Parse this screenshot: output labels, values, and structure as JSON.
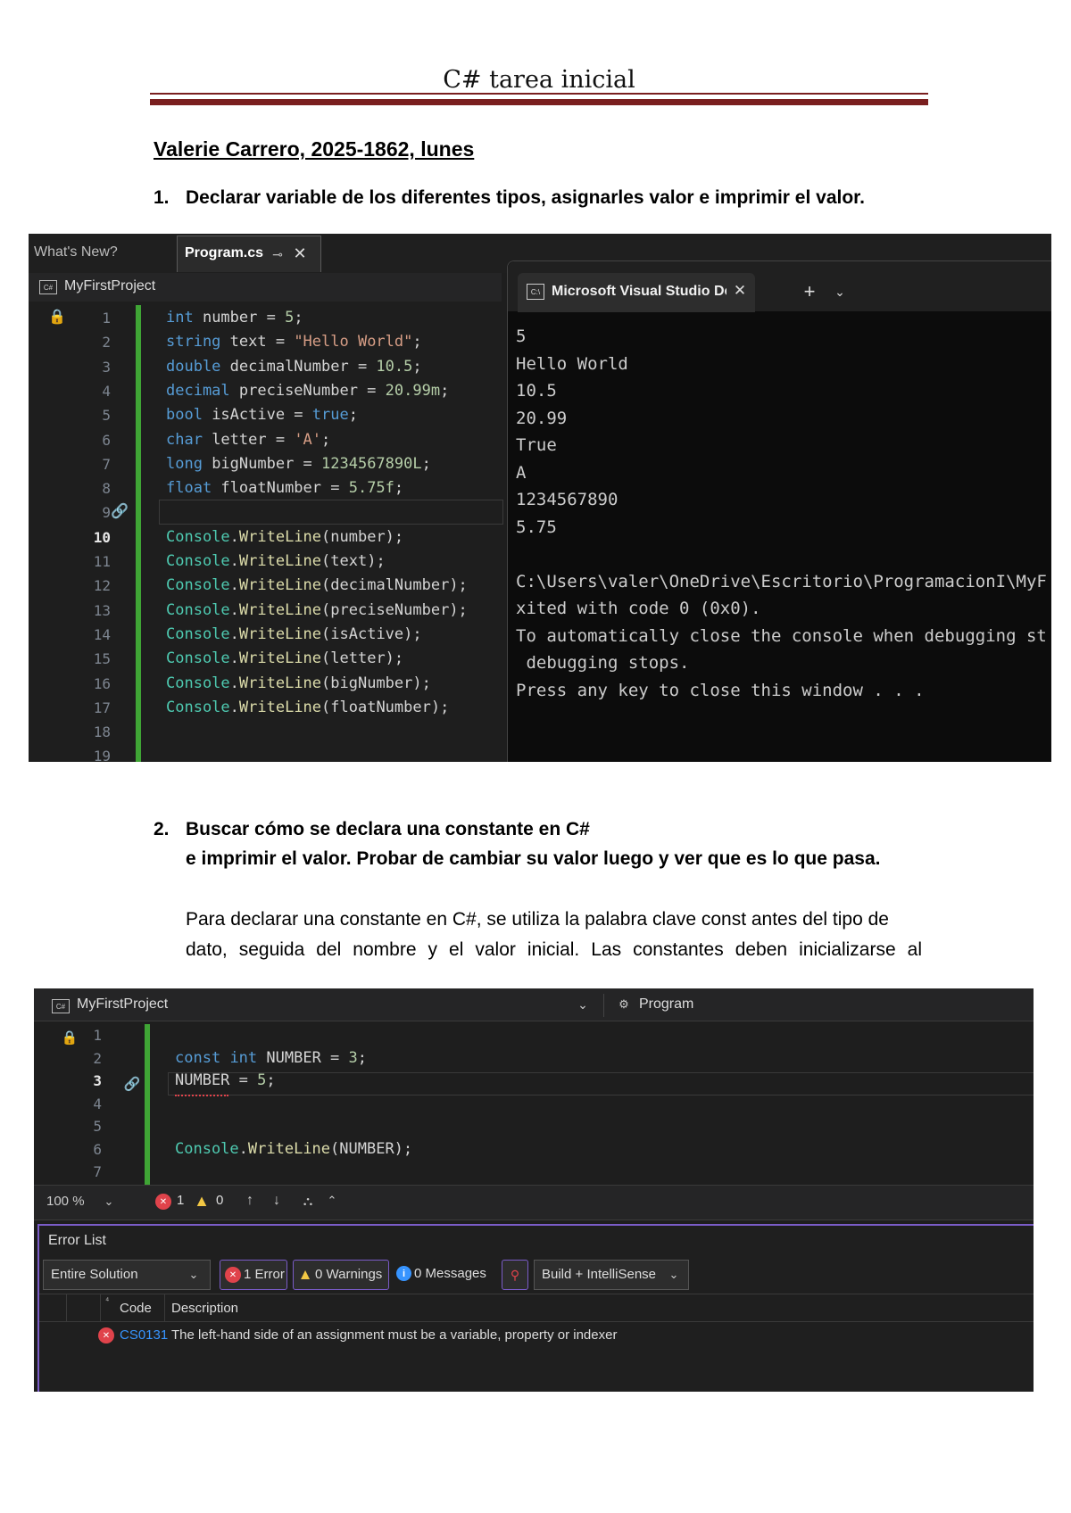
{
  "document": {
    "title": "C# tarea inicial",
    "author_line": "Valerie Carrero, 2025-1862, lunes",
    "q1_number": "1.",
    "q1_text": "Declarar variable de los diferentes tipos, asignarles valor e imprimir el valor.",
    "q2_number": "2.",
    "q2_line1": "Buscar cómo se declara una constante en C#",
    "q2_line2": "e imprimir el valor.  Probar de cambiar su valor luego y ver que es lo que pasa.",
    "q2_para_line1": "Para declarar una constante en C#, se utiliza la palabra clave const antes del tipo de",
    "q2_para_line2": "dato, seguida del nombre y el valor inicial. Las constantes deben inicializarse al"
  },
  "shot1": {
    "tab_whats_new": "What's New?",
    "tab_program": "Program.cs",
    "project": "MyFirstProject",
    "console_tab": "Microsoft Visual Studio Debu",
    "console_plus": "+",
    "code": [
      {
        "ln": "1",
        "parts": [
          [
            "kw",
            "int"
          ],
          [
            "id",
            " number = "
          ],
          [
            "num",
            "5"
          ],
          [
            "id",
            ";"
          ]
        ]
      },
      {
        "ln": "2",
        "parts": [
          [
            "kw",
            "string"
          ],
          [
            "id",
            " text = "
          ],
          [
            "str",
            "\"Hello World\""
          ],
          [
            "id",
            ";"
          ]
        ]
      },
      {
        "ln": "3",
        "parts": [
          [
            "kw",
            "double"
          ],
          [
            "id",
            " decimalNumber = "
          ],
          [
            "num",
            "10.5"
          ],
          [
            "id",
            ";"
          ]
        ]
      },
      {
        "ln": "4",
        "parts": [
          [
            "kw",
            "decimal"
          ],
          [
            "id",
            " preciseNumber = "
          ],
          [
            "num",
            "20.99m"
          ],
          [
            "id",
            ";"
          ]
        ]
      },
      {
        "ln": "5",
        "parts": [
          [
            "kw",
            "bool"
          ],
          [
            "id",
            " isActive = "
          ],
          [
            "kw",
            "true"
          ],
          [
            "id",
            ";"
          ]
        ]
      },
      {
        "ln": "6",
        "parts": [
          [
            "kw",
            "char"
          ],
          [
            "id",
            " letter = "
          ],
          [
            "str",
            "'A'"
          ],
          [
            "id",
            ";"
          ]
        ]
      },
      {
        "ln": "7",
        "parts": [
          [
            "kw",
            "long"
          ],
          [
            "id",
            " bigNumber = "
          ],
          [
            "num",
            "1234567890L"
          ],
          [
            "id",
            ";"
          ]
        ]
      },
      {
        "ln": "8",
        "parts": [
          [
            "kw",
            "float"
          ],
          [
            "id",
            " floatNumber = "
          ],
          [
            "num",
            "5.75f"
          ],
          [
            "id",
            ";"
          ]
        ]
      },
      {
        "ln": "9",
        "parts": []
      },
      {
        "ln": "10",
        "parts": [
          [
            "type",
            "Console"
          ],
          [
            "id",
            "."
          ],
          [
            "mth",
            "WriteLine"
          ],
          [
            "id",
            "(number);"
          ]
        ]
      },
      {
        "ln": "11",
        "parts": [
          [
            "type",
            "Console"
          ],
          [
            "id",
            "."
          ],
          [
            "mth",
            "WriteLine"
          ],
          [
            "id",
            "(text);"
          ]
        ]
      },
      {
        "ln": "12",
        "parts": [
          [
            "type",
            "Console"
          ],
          [
            "id",
            "."
          ],
          [
            "mth",
            "WriteLine"
          ],
          [
            "id",
            "(decimalNumber);"
          ]
        ]
      },
      {
        "ln": "13",
        "parts": [
          [
            "type",
            "Console"
          ],
          [
            "id",
            "."
          ],
          [
            "mth",
            "WriteLine"
          ],
          [
            "id",
            "(preciseNumber);"
          ]
        ]
      },
      {
        "ln": "14",
        "parts": [
          [
            "type",
            "Console"
          ],
          [
            "id",
            "."
          ],
          [
            "mth",
            "WriteLine"
          ],
          [
            "id",
            "(isActive);"
          ]
        ]
      },
      {
        "ln": "15",
        "parts": [
          [
            "type",
            "Console"
          ],
          [
            "id",
            "."
          ],
          [
            "mth",
            "WriteLine"
          ],
          [
            "id",
            "(letter);"
          ]
        ]
      },
      {
        "ln": "16",
        "parts": [
          [
            "type",
            "Console"
          ],
          [
            "id",
            "."
          ],
          [
            "mth",
            "WriteLine"
          ],
          [
            "id",
            "(bigNumber);"
          ]
        ]
      },
      {
        "ln": "17",
        "parts": [
          [
            "type",
            "Console"
          ],
          [
            "id",
            "."
          ],
          [
            "mth",
            "WriteLine"
          ],
          [
            "id",
            "(floatNumber);"
          ]
        ]
      },
      {
        "ln": "18",
        "parts": []
      },
      {
        "ln": "19",
        "parts": []
      }
    ],
    "console_lines": [
      "5",
      "Hello World",
      "10.5",
      "20.99",
      "True",
      "A",
      "1234567890",
      "5.75",
      "",
      "C:\\Users\\valer\\OneDrive\\Escritorio\\ProgramacionI\\MyF",
      "xited with code 0 (0x0).",
      "To automatically close the console when debugging st",
      " debugging stops.",
      "Press any key to close this window . . ."
    ]
  },
  "shot2": {
    "project": "MyFirstProject",
    "member_dropdown": "Program",
    "code": [
      {
        "ln": "1",
        "parts": []
      },
      {
        "ln": "2",
        "parts": [
          [
            "kw",
            "const"
          ],
          [
            "id",
            " "
          ],
          [
            "kw",
            "int"
          ],
          [
            "id",
            " NUMBER = "
          ],
          [
            "num",
            "3"
          ],
          [
            "id",
            ";"
          ]
        ]
      },
      {
        "ln": "3",
        "parts": [
          [
            "id",
            "NUMBER = "
          ],
          [
            "num",
            "5"
          ],
          [
            "id",
            ";"
          ]
        ]
      },
      {
        "ln": "4",
        "parts": []
      },
      {
        "ln": "5",
        "parts": []
      },
      {
        "ln": "6",
        "parts": [
          [
            "type",
            "Console"
          ],
          [
            "id",
            "."
          ],
          [
            "mth",
            "WriteLine"
          ],
          [
            "id",
            "(NUMBER);"
          ]
        ]
      },
      {
        "ln": "7",
        "parts": []
      }
    ],
    "zoom": "100 %",
    "status_errors": "1",
    "status_warnings": "0",
    "error_list_title": "Error List",
    "scope": "Entire Solution",
    "btn_errors": "1 Error",
    "btn_warnings": "0 Warnings",
    "btn_messages": "0 Messages",
    "build_filter": "Build + IntelliSense",
    "col_code": "Code",
    "col_description": "Description",
    "error_code": "CS0131",
    "error_description": "The left-hand side of an assignment must be a variable, property or indexer"
  },
  "colors": {
    "rule": "#7a1f1f",
    "ide_bg": "#1e1e1e",
    "keyword": "#569cd6",
    "error": "#e0434b"
  }
}
